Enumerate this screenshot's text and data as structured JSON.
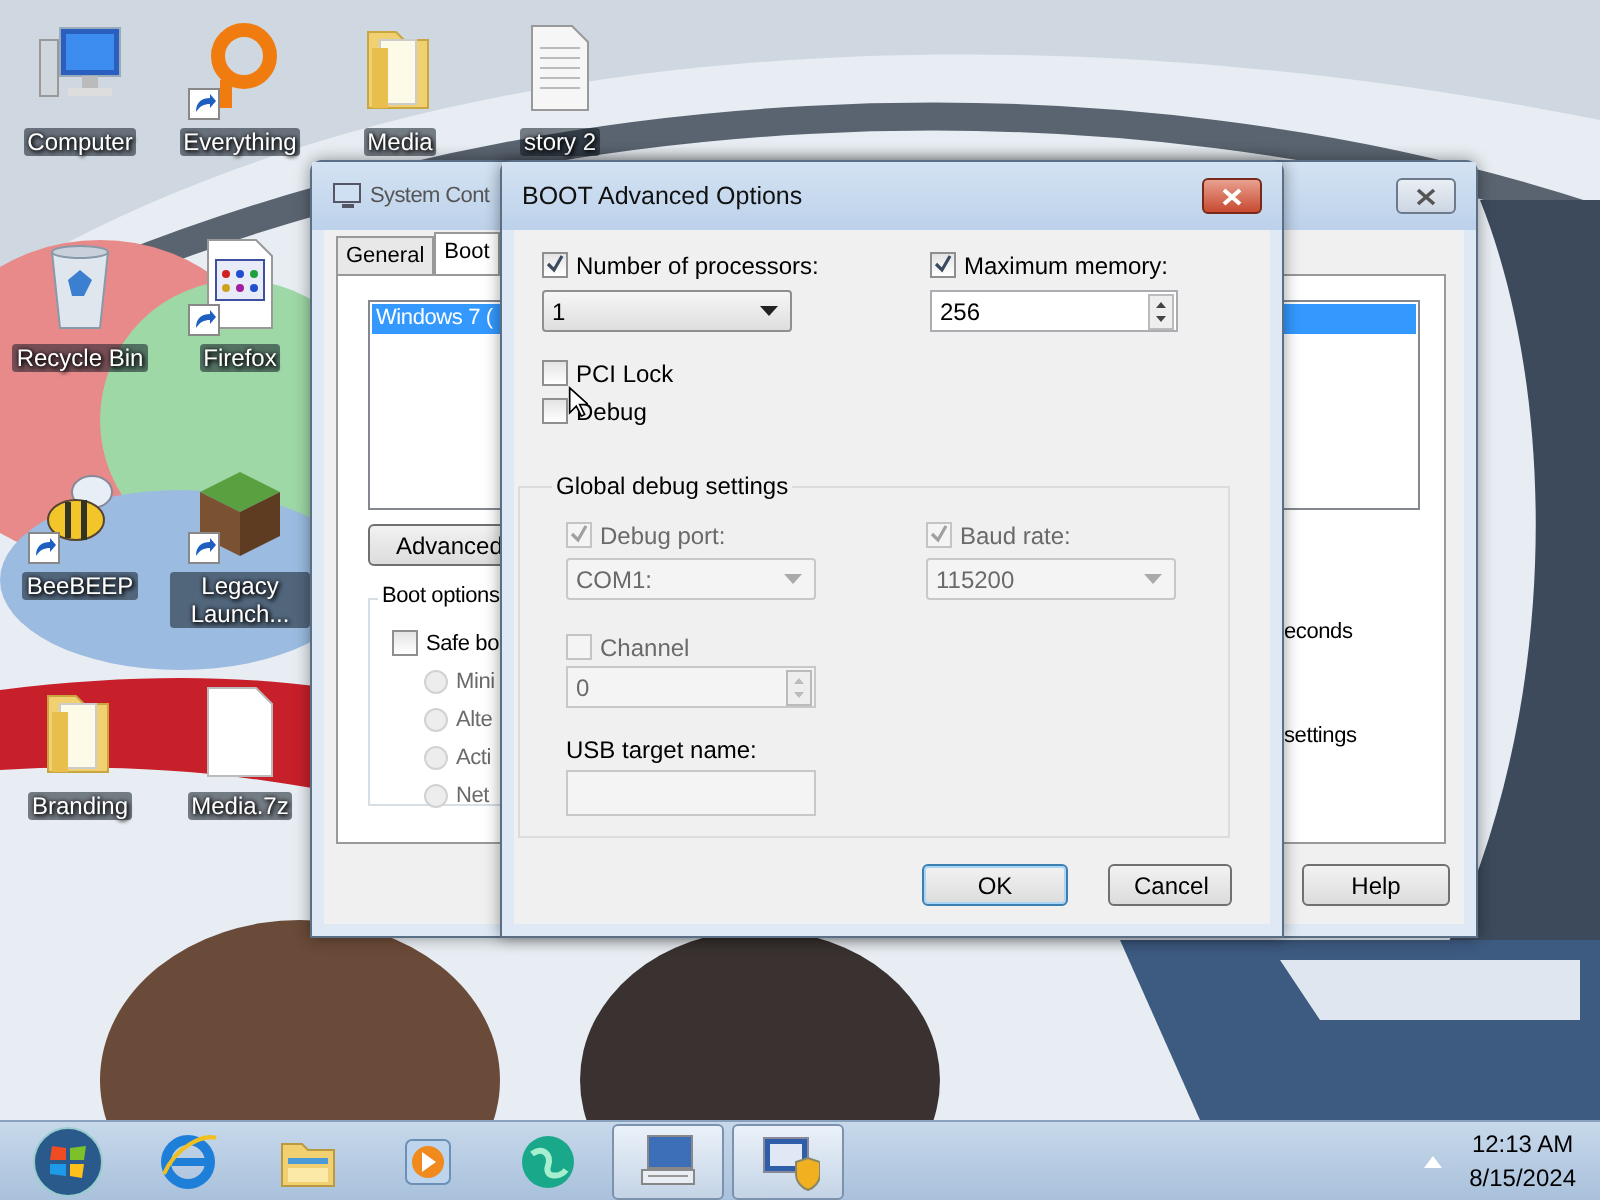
{
  "desktop_icons": [
    {
      "label": "Computer",
      "kind": "computer",
      "shortcut": false
    },
    {
      "label": "Everything",
      "kind": "ring",
      "shortcut": true
    },
    {
      "label": "Media",
      "kind": "folder",
      "shortcut": false
    },
    {
      "label": "story 2",
      "kind": "document",
      "shortcut": false
    },
    {
      "label": "Recycle Bin",
      "kind": "recycle",
      "shortcut": false
    },
    {
      "label": "Firefox",
      "kind": "grid-file",
      "shortcut": true
    },
    {
      "label": "BeeBEEP",
      "kind": "bee",
      "shortcut": true
    },
    {
      "label": "Legacy Launch...",
      "kind": "block",
      "shortcut": true
    },
    {
      "label": "Branding",
      "kind": "folder",
      "shortcut": false
    },
    {
      "label": "Media.7z",
      "kind": "blank-file",
      "shortcut": false
    }
  ],
  "system_configuration": {
    "title": "System Cont",
    "tabs": [
      {
        "label": "General",
        "selected": false
      },
      {
        "label": "Boot",
        "selected": true
      }
    ],
    "boot_list": [
      {
        "label": "Windows 7 (",
        "selected": true
      }
    ],
    "advanced_button": "Advanced",
    "boot_options": {
      "legend": "Boot options",
      "safe_boot": {
        "label": "Safe bo",
        "checked": false
      },
      "radios": [
        {
          "label": "Mini",
          "selected": false,
          "disabled": true
        },
        {
          "label": "Alte",
          "selected": false,
          "disabled": true
        },
        {
          "label": "Acti",
          "selected": false,
          "disabled": true
        },
        {
          "label": "Net",
          "selected": false,
          "disabled": true
        }
      ]
    },
    "timeout_text": "econds",
    "settings_text": "settings",
    "help_button": "Help"
  },
  "boot_advanced_options": {
    "title": "BOOT Advanced Options",
    "number_of_processors": {
      "label": "Number of processors:",
      "checked": true,
      "value": "1"
    },
    "maximum_memory": {
      "label": "Maximum memory:",
      "checked": true,
      "value": "256"
    },
    "pci_lock": {
      "label": "PCI Lock",
      "checked": false
    },
    "debug": {
      "label": "Debug",
      "checked": false
    },
    "global_debug_settings": {
      "legend": "Global debug settings",
      "disabled": true,
      "debug_port": {
        "label": "Debug port:",
        "checked": true,
        "value": "COM1:"
      },
      "baud_rate": {
        "label": "Baud rate:",
        "checked": true,
        "value": "115200"
      },
      "channel": {
        "label": "Channel",
        "checked": false,
        "value": "0"
      },
      "usb_target_name": {
        "label": "USB target name:"
      }
    },
    "buttons": [
      {
        "label": "OK",
        "default": true
      },
      {
        "label": "Cancel",
        "default": false
      }
    ]
  },
  "taskbar": {
    "items": [
      {
        "kind": "start",
        "active": false
      },
      {
        "kind": "browser",
        "active": false
      },
      {
        "kind": "explorer",
        "active": false
      },
      {
        "kind": "media",
        "active": false
      },
      {
        "kind": "globe",
        "active": false
      },
      {
        "kind": "keyboard-monitor",
        "active": true
      },
      {
        "kind": "monitor-shield",
        "active": true
      }
    ],
    "clock": {
      "time": "12:13 AM",
      "date": "8/15/2024"
    }
  }
}
